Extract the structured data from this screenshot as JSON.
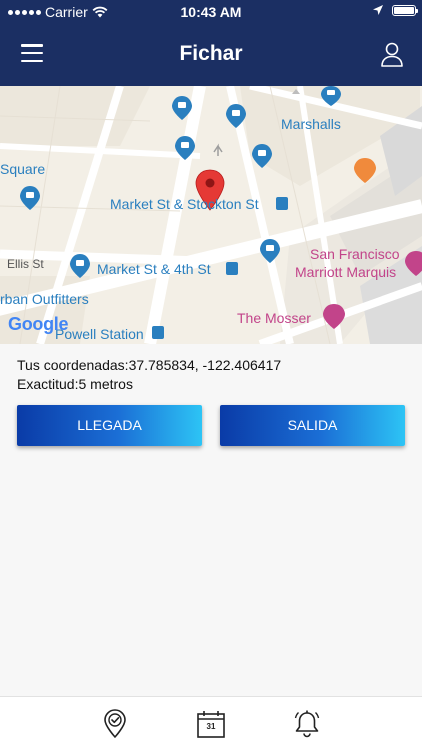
{
  "status_bar": {
    "carrier": "Carrier",
    "time": "10:43 AM"
  },
  "nav": {
    "title": "Fichar",
    "menu_icon": "hamburger-menu-icon",
    "user_icon": "user-profile-icon"
  },
  "map": {
    "labels": {
      "square": "Square",
      "marshalls": "Marshalls",
      "market_stockton": "Market St & Stockton St",
      "ellis_st": "Ellis St",
      "market_4th": "Market St & 4th St",
      "sf_marriott_1": "San Francisco",
      "sf_marriott_2": "Marriott Marquis",
      "urban_outfitters": "rban Outfitters",
      "mosser": "The Mosser",
      "powell_station": "Powell Station",
      "google": "Google"
    },
    "colors": {
      "poi_blue": "#2a7fbf",
      "poi_pink": "#c2448a",
      "marker_red": "#e53935"
    }
  },
  "location": {
    "coords_label": "Tus coordenadas:",
    "coords_value": "37.785834, -122.406417",
    "accuracy_label": "Exactitud:",
    "accuracy_value": "5 metros"
  },
  "actions": {
    "arrival": "LLEGADA",
    "departure": "SALIDA"
  },
  "tab_bar": {
    "calendar_day": "31",
    "icons": [
      "location-check-icon",
      "calendar-icon",
      "bell-icon"
    ]
  },
  "theme": {
    "header_bg": "#1b2f63",
    "button_gradient_start": "#0a3ba7",
    "button_gradient_end": "#2dc4f5"
  }
}
